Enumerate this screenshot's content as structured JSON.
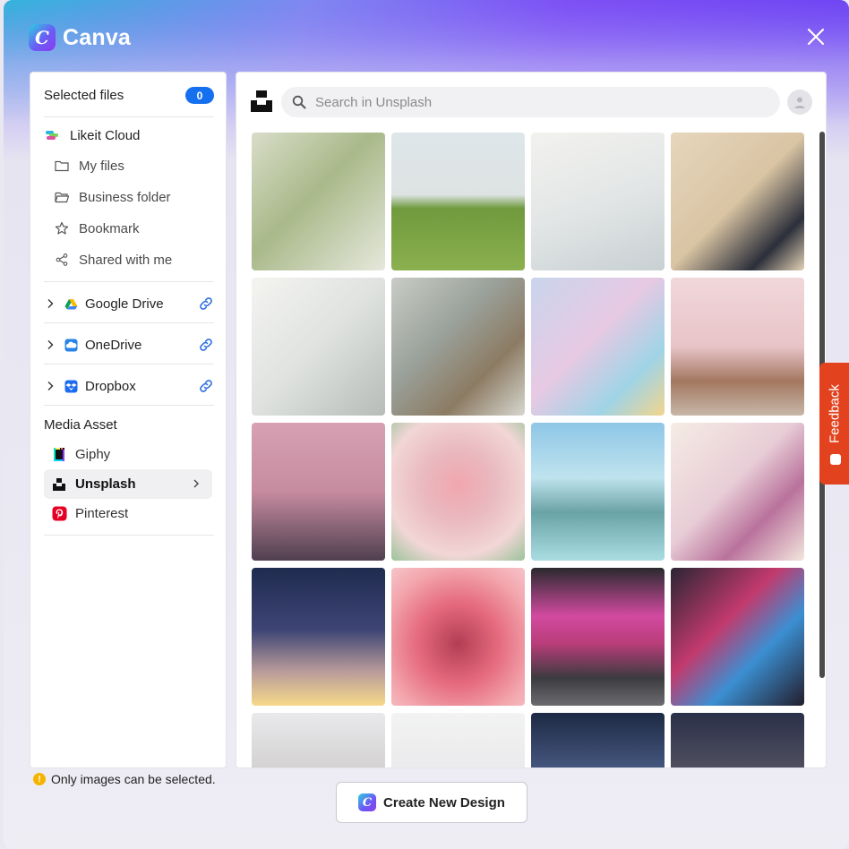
{
  "app": {
    "name": "Canva"
  },
  "sidebar": {
    "selected_files_label": "Selected files",
    "selected_count": "0",
    "cloud": {
      "title": "Likeit Cloud",
      "items": [
        {
          "label": "My files",
          "icon": "folder-icon"
        },
        {
          "label": "Business folder",
          "icon": "folder-open-icon"
        },
        {
          "label": "Bookmark",
          "icon": "star-icon"
        },
        {
          "label": "Shared with me",
          "icon": "share-icon"
        }
      ]
    },
    "connections": [
      {
        "label": "Google Drive",
        "icon": "google-drive-icon"
      },
      {
        "label": "OneDrive",
        "icon": "onedrive-icon"
      },
      {
        "label": "Dropbox",
        "icon": "dropbox-icon"
      }
    ],
    "media_asset_title": "Media Asset",
    "assets": [
      {
        "label": "Giphy",
        "icon": "giphy-icon"
      },
      {
        "label": "Unsplash",
        "icon": "unsplash-icon",
        "active": true
      },
      {
        "label": "Pinterest",
        "icon": "pinterest-icon"
      }
    ]
  },
  "search": {
    "placeholder": "Search in Unsplash",
    "value": ""
  },
  "images": [
    {
      "name": "branches-film",
      "bg": "linear-gradient(135deg,#d9ddc8 0%,#a9b98a 45%,#e6e8dc 100%)"
    },
    {
      "name": "lone-tree-hill",
      "bg": "linear-gradient(180deg,#dfe6ea 0%,#dde3e2 45%,#6f9a3d 55%,#8bb04f 100%)"
    },
    {
      "name": "books-stack",
      "bg": "linear-gradient(160deg,#f2f2ef 0%,#e3e6e6 50%,#c8d0d3 100%)"
    },
    {
      "name": "wine-bottles",
      "bg": "linear-gradient(135deg,#e7d6bd 0%,#d9c4a3 50%,#2c2f3a 80%,#e4d2b6 100%)"
    },
    {
      "name": "white-building-film",
      "bg": "linear-gradient(135deg,#f4f4f1 0%,#dfe2df 50%,#b7bcb8 100%)"
    },
    {
      "name": "rocky-shore",
      "bg": "linear-gradient(135deg,#c9ccc6 0%,#9aa19a 40%,#8c7b63 70%,#d7d7d0 100%)"
    },
    {
      "name": "3d-shapes",
      "bg": "linear-gradient(135deg,#c9d5ec 0%,#e7c9e3 45%,#9fd4e6 75%,#f2d58c 100%)"
    },
    {
      "name": "cherry-blossom-house",
      "bg": "linear-gradient(180deg,#f1d7d9 0%,#e8c4c8 50%,#a37760 75%,#c8b7a8 100%)"
    },
    {
      "name": "pink-clouds",
      "bg": "linear-gradient(180deg,#d7a1b3 0%,#c68b9f 50%,#4f3f4f 100%)"
    },
    {
      "name": "pink-tulip",
      "bg": "radial-gradient(circle at 50% 45%,#f1a6ae 0%,#e9b9bf 35%,#f2d6d6 70%,#9bc39a 100%)"
    },
    {
      "name": "fountain-park",
      "bg": "linear-gradient(180deg,#8ec7e6 0%,#bfe3ee 40%,#6aa3a5 65%,#a9dde2 100%)"
    },
    {
      "name": "magnolia-branch",
      "bg": "linear-gradient(135deg,#f5ece4 0%,#e8cdd6 45%,#b9729c 70%,#f3e6dd 100%)"
    },
    {
      "name": "starry-gradient-sky",
      "bg": "linear-gradient(180deg,#1f2b4f 0%,#3e4575 45%,#b89b9a 75%,#f6d98a 100%)"
    },
    {
      "name": "pink-cube-macro",
      "bg": "radial-gradient(circle at 50% 55%,#b23e55 0%,#e56a7d 40%,#f3a6ae 75%,#f6c4c8 100%)"
    },
    {
      "name": "neon-lantern-station",
      "bg": "linear-gradient(180deg,#2a2a2e 0%,#d24aa0 35%,#b83d79 55%,#3b3b40 80%,#6b6b70 100%)"
    },
    {
      "name": "neon-street-night",
      "bg": "linear-gradient(135deg,#2b2534 0%,#c23a6d 40%,#3b8fd2 65%,#231d2a 100%)"
    },
    {
      "name": "city-facade",
      "bg": "linear-gradient(180deg,#e9e9ec 0%,#c9c6c4 60%,#a9a39f 100%)"
    },
    {
      "name": "white-flowers",
      "bg": "linear-gradient(180deg,#f2f3f2 0%,#e7e6ea 60%,#d9d2dc 100%)"
    },
    {
      "name": "city-lights-aerial",
      "bg": "linear-gradient(180deg,#1d2a44 0%,#4a5c86 45%,#d9a35f 100%)"
    },
    {
      "name": "night-sky-clouds",
      "bg": "linear-gradient(180deg,#2a3049 0%,#5e5a67 55%,#c79b62 100%)"
    }
  ],
  "footer": {
    "note": "Only images can be selected.",
    "create_button": "Create New Design"
  },
  "feedback_label": "Feedback"
}
